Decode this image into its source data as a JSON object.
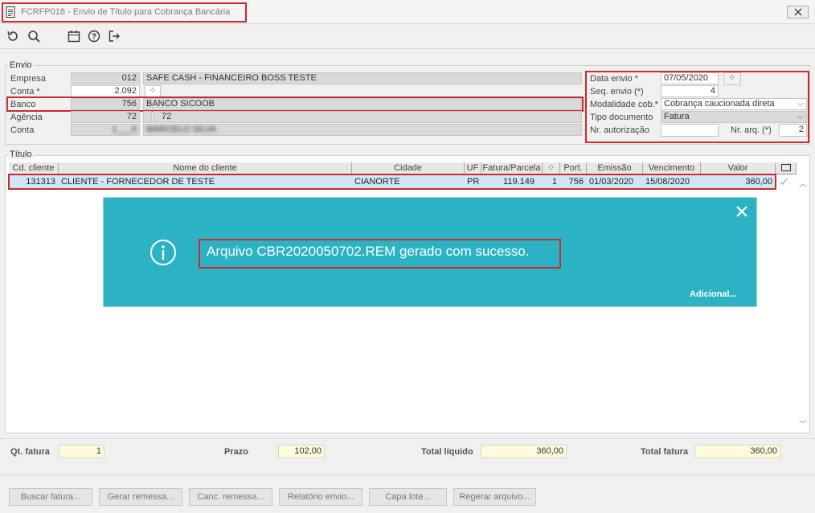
{
  "window": {
    "title": "FCRFP018 - Envio de Título para Cobrança Bancária"
  },
  "icons": [
    "document-icon",
    "refresh-icon",
    "search-icon",
    "calendar-icon",
    "help-icon",
    "exit-icon",
    "close-icon",
    "info-icon"
  ],
  "envio": {
    "label": "Envio",
    "empresa": {
      "label": "Empresa",
      "code": "012",
      "name": "SAFE CASH - FINANCEIRO BOSS TESTE"
    },
    "conta": {
      "label": "Conta *",
      "value": "2.092"
    },
    "banco": {
      "label": "Banco",
      "code": "756",
      "name": "BANCO SICOOB"
    },
    "agencia": {
      "label": "Agência",
      "code": "72",
      "name": "72"
    },
    "conta2": {
      "label": "Conta",
      "code": "1___6",
      "name": "MARCELO SILVA"
    },
    "data_envio": {
      "label": "Data envio *",
      "value": "07/05/2020"
    },
    "seq_envio": {
      "label": "Seq. envio (*)",
      "value": "4"
    },
    "modalidade": {
      "label": "Modalidade cob.*",
      "value": "Cobrança caucionada direta"
    },
    "tipo_documento": {
      "label": "Tipo documento",
      "value": "Fatura"
    },
    "nr_autorizacao": {
      "label": "Nr. autorização",
      "value": ""
    },
    "nr_arq": {
      "label": "Nr. arq. (*)",
      "value": "2"
    }
  },
  "titulo": {
    "label": "Título",
    "columns": [
      "Cd. cliente",
      "Nome do cliente",
      "Cidade",
      "UF",
      "Fatura/Parcela",
      "",
      "Port.",
      "Emissão",
      "Vencimento",
      "Valor"
    ],
    "rows": [
      {
        "cd_cliente": "131313",
        "nome": "CLIENTE - FORNECEDOR DE TESTE",
        "cidade": "CIANORTE",
        "uf": "PR",
        "fatura": "119.149",
        "parcela": "1",
        "port": "756",
        "emissao": "01/03/2020",
        "vencimento": "15/08/2020",
        "valor": "360,00"
      }
    ]
  },
  "toast": {
    "message": "Arquivo CBR2020050702.REM gerado com sucesso.",
    "link": "Adicional..."
  },
  "totals": {
    "qt_fatura": {
      "label": "Qt. fatura",
      "value": "1"
    },
    "prazo": {
      "label": "Prazo",
      "value": "102,00"
    },
    "total_liquido": {
      "label": "Total líquido",
      "value": "360,00"
    },
    "total_fatura": {
      "label": "Total fatura",
      "value": "360,00"
    }
  },
  "buttons": [
    "Buscar fatura...",
    "Gerar remessa...",
    "Canc. remessa...",
    "Relatório envio...",
    "Capa lote...",
    "Regerar arquivo..."
  ],
  "colors": {
    "toast": "#2bb3c4",
    "highlight_red": "#d0282d",
    "row_selected": "#cde8f4",
    "total_field": "#fefbdc"
  }
}
